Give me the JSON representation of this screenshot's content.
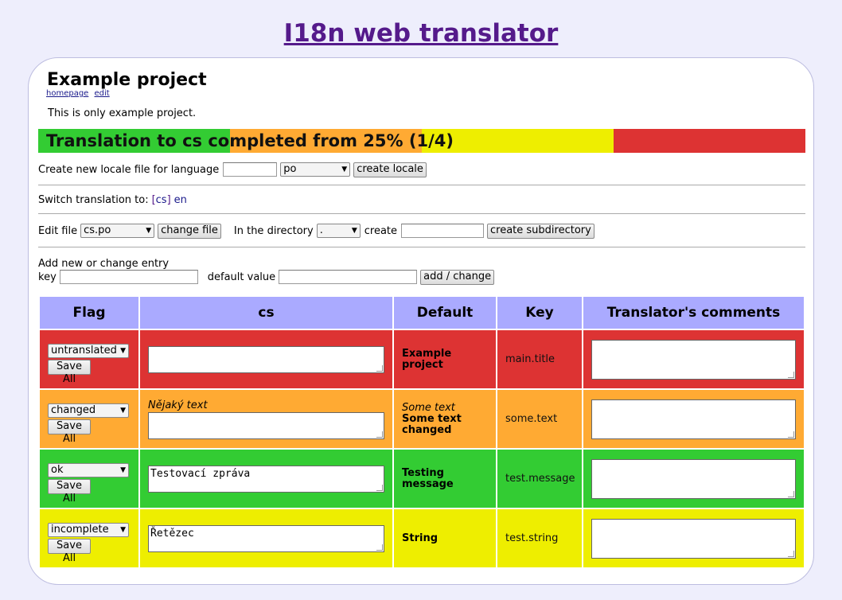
{
  "site_title": "I18n web translator",
  "project": {
    "title": "Example project",
    "links": {
      "homepage": "homepage",
      "edit": "edit"
    },
    "description": "This is only example project."
  },
  "progress": {
    "text": "Translation to cs completed from 25% (1/4)",
    "segments": [
      {
        "status": "ok",
        "fraction": 0.25
      },
      {
        "status": "changed",
        "fraction": 0.25
      },
      {
        "status": "incomplete",
        "fraction": 0.25
      },
      {
        "status": "untranslated",
        "fraction": 0.25
      }
    ]
  },
  "create_locale": {
    "label": "Create new locale file for language",
    "language_value": "",
    "format_selected": "po",
    "button": "create locale"
  },
  "switch": {
    "label": "Switch translation to:",
    "current": "cs",
    "other": "en"
  },
  "edit_file": {
    "label": "Edit file",
    "file_selected": "cs.po",
    "change_button": "change file",
    "directory_label": "In the directory",
    "directory_selected": ".",
    "create_label": "create",
    "create_value": "",
    "create_button": "create subdirectory"
  },
  "add_entry": {
    "heading": "Add new or change entry",
    "key_label": "key",
    "key_value": "",
    "default_label": "default value",
    "default_value": "",
    "button": "add / change"
  },
  "table": {
    "headers": [
      "Flag",
      "cs",
      "Default",
      "Key",
      "Translator's comments"
    ],
    "save_label": "Save All",
    "rows": [
      {
        "flag": "untranslated",
        "old_cs": "",
        "cs": "",
        "old_default": "",
        "default": "Example project",
        "key": "main.title",
        "comment": ""
      },
      {
        "flag": "changed",
        "old_cs": "Nějaký text",
        "cs": "",
        "old_default": "Some text",
        "default": "Some text changed",
        "key": "some.text",
        "comment": ""
      },
      {
        "flag": "ok",
        "old_cs": "",
        "cs": "Testovací zpráva",
        "old_default": "",
        "default": "Testing message",
        "key": "test.message",
        "comment": ""
      },
      {
        "flag": "incomplete",
        "old_cs": "",
        "cs": "Řetězec",
        "old_default": "",
        "default": "String",
        "key": "test.string",
        "comment": ""
      }
    ]
  },
  "colors": {
    "ok": "#33cc33",
    "changed": "#ffaa33",
    "incomplete": "#eeee00",
    "untranslated": "#dd3333",
    "header": "#aaaaff",
    "title_link": "#551a8b"
  }
}
